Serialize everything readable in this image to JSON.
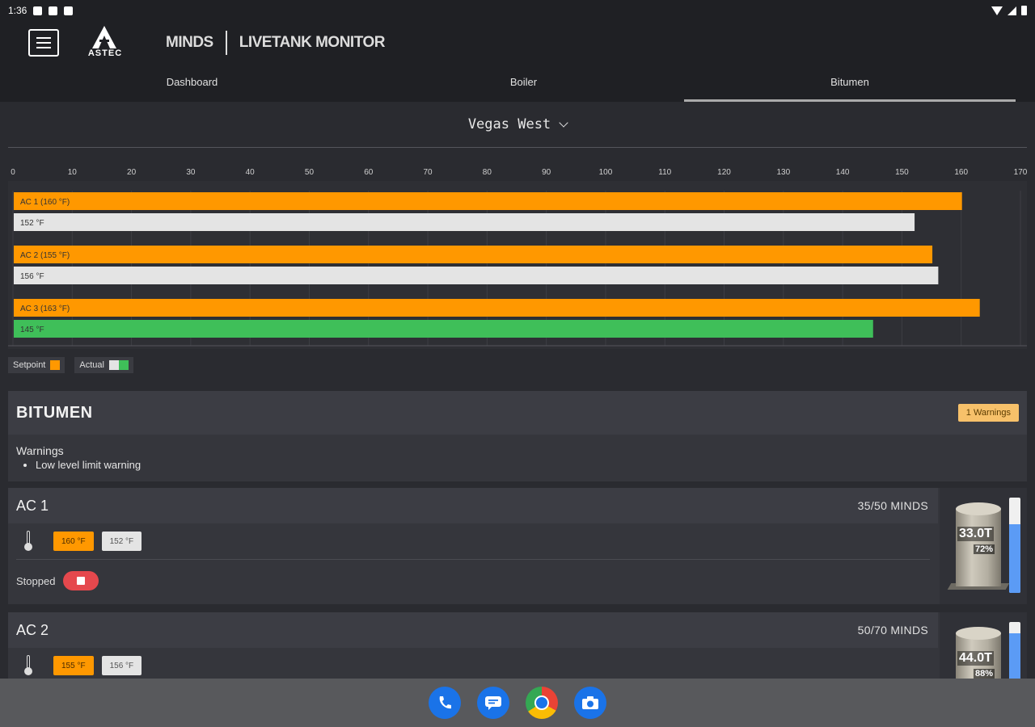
{
  "status_bar": {
    "time": "1:36"
  },
  "header": {
    "logo_text": "ASTEC",
    "brand_left": "MINDS",
    "brand_right": "LIVETANK MONITOR",
    "tabs": [
      {
        "label": "Dashboard",
        "active": false
      },
      {
        "label": "Boiler",
        "active": false
      },
      {
        "label": "Bitumen",
        "active": true
      }
    ]
  },
  "location": {
    "selected": "Vegas West"
  },
  "colors": {
    "setpoint": "#ff9800",
    "actual": "#e4e4e4",
    "actual_ok": "#3fbf59",
    "accent": "#5b9bf5",
    "warning": "#f7c16a",
    "stop": "#e5484d"
  },
  "chart_data": {
    "type": "bar",
    "orientation": "horizontal",
    "xlim": [
      0,
      170
    ],
    "x_ticks": [
      0,
      10,
      20,
      30,
      40,
      50,
      60,
      70,
      80,
      90,
      100,
      110,
      120,
      130,
      140,
      150,
      160,
      170
    ],
    "bars": [
      {
        "label": "AC 1 (160 °F)",
        "value": 160,
        "kind": "setpoint",
        "color": "#ff9800"
      },
      {
        "label": "152 °F",
        "value": 152,
        "kind": "actual",
        "color": "#e4e4e4"
      },
      {
        "label": "AC 2 (155 °F)",
        "value": 155,
        "kind": "setpoint",
        "color": "#ff9800"
      },
      {
        "label": "156 °F",
        "value": 156,
        "kind": "actual",
        "color": "#e4e4e4"
      },
      {
        "label": "AC 3 (163 °F)",
        "value": 163,
        "kind": "setpoint",
        "color": "#ff9800"
      },
      {
        "label": "145 °F",
        "value": 145,
        "kind": "actual",
        "color": "#3fbf59"
      }
    ],
    "legend": [
      {
        "name": "Setpoint"
      },
      {
        "name": "Actual"
      }
    ],
    "grid": true
  },
  "bitumen": {
    "title": "BITUMEN",
    "warning_badge": "1 Warnings",
    "warnings_heading": "Warnings",
    "warnings": [
      "Low level limit warning"
    ]
  },
  "tanks": [
    {
      "name": "AC 1",
      "minds": "35/50 MINDS",
      "setpoint": "160 °F",
      "actual": "152 °F",
      "status": "Stopped",
      "tonnage": "33.0T",
      "percent_label": "72%",
      "level": 0.72
    },
    {
      "name": "AC 2",
      "minds": "50/70 MINDS",
      "setpoint": "155 °F",
      "actual": "156 °F",
      "status": "",
      "tonnage": "44.0T",
      "percent_label": "88%",
      "level": 0.88
    }
  ]
}
